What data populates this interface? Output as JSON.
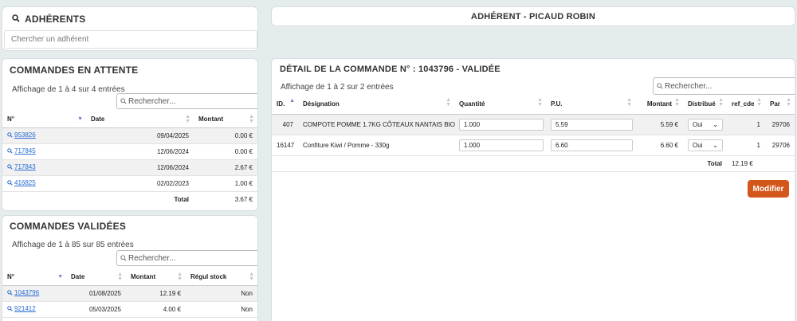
{
  "adherents": {
    "title": "ADHÉRENTS",
    "search_placeholder": "Chercher un adhérent"
  },
  "adherent_header": {
    "title": "ADHÉRENT - PICAUD ROBIN"
  },
  "attente": {
    "title": "COMMANDES EN ATTENTE",
    "info": "Affichage de 1 à 4 sur 4 entrées",
    "search_placeholder": "Rechercher...",
    "columns": [
      "N°",
      "Date",
      "Montant"
    ],
    "rows": [
      {
        "num": "953826",
        "date": "09/04/2025",
        "montant": "0.00 €"
      },
      {
        "num": "717845",
        "date": "12/06/2024",
        "montant": "0.00 €"
      },
      {
        "num": "717843",
        "date": "12/06/2024",
        "montant": "2.67 €"
      },
      {
        "num": "416825",
        "date": "02/02/2023",
        "montant": "1.00 €"
      }
    ],
    "total_label": "Total",
    "total_value": "3.67 €"
  },
  "validees": {
    "title": "COMMANDES VALIDÉES",
    "info": "Affichage de 1 à 85 sur 85 entrées",
    "search_placeholder": "Rechercher...",
    "columns": [
      "N°",
      "Date",
      "Montant",
      "Régul stock"
    ],
    "rows": [
      {
        "num": "1043796",
        "date": "01/08/2025",
        "montant": "12.19 €",
        "regul": "Non"
      },
      {
        "num": "921412",
        "date": "05/03/2025",
        "montant": "4.00 €",
        "regul": "Non"
      }
    ]
  },
  "detail": {
    "title": "DÉTAIL DE LA COMMANDE N° : 1043796 - VALIDÉE",
    "info": "Affichage de 1 à 2 sur 2 entrées",
    "search_placeholder": "Rechercher...",
    "columns": [
      "ID.",
      "Désignation",
      "Quantité",
      "P.U.",
      "Montant",
      "Distribué",
      "ref_cde",
      "Par"
    ],
    "rows": [
      {
        "id": "407",
        "designation": "COMPOTE POMME 1.7KG CÔTEAUX NANTAIS BIO",
        "quantite": "1.000",
        "pu": "5.59",
        "montant": "5.59 €",
        "distribue": "Oui",
        "ref_cde": "1",
        "par": "29706"
      },
      {
        "id": "16147",
        "designation": "Confiture Kiwi / Pomme - 330g",
        "quantite": "1.000",
        "pu": "6.60",
        "montant": "6.60 €",
        "distribue": "Oui",
        "ref_cde": "1",
        "par": "29706"
      }
    ],
    "total_label": "Total",
    "total_value": "12.19 €",
    "modify_label": "Modifier"
  },
  "colors": {
    "accent_button": "#d3561a",
    "link": "#2a6bd3",
    "background": "#e4ecee"
  }
}
